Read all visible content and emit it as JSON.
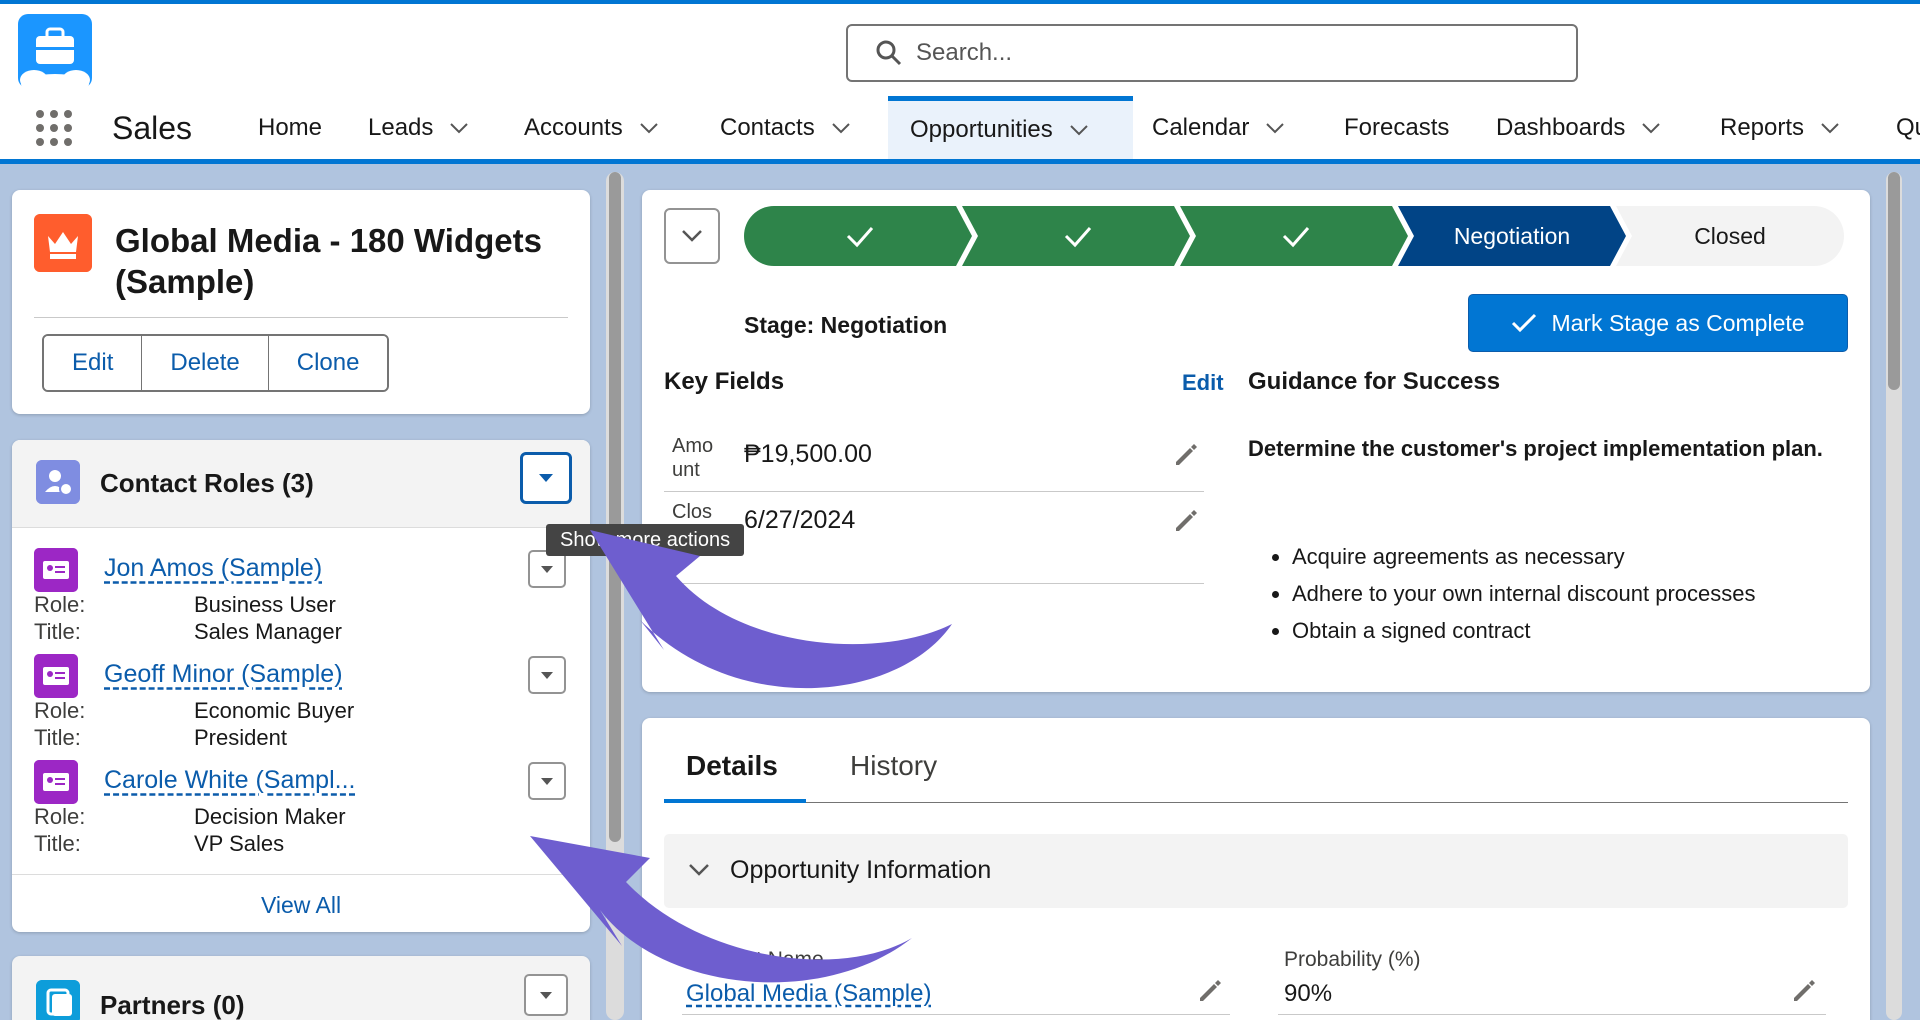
{
  "header": {
    "search_placeholder": "Search...",
    "app_name": "Sales"
  },
  "nav": {
    "items": [
      {
        "label": "Home",
        "has_menu": false
      },
      {
        "label": "Leads",
        "has_menu": true
      },
      {
        "label": "Accounts",
        "has_menu": true
      },
      {
        "label": "Contacts",
        "has_menu": true
      },
      {
        "label": "Opportunities",
        "has_menu": true,
        "active": true
      },
      {
        "label": "Calendar",
        "has_menu": true
      },
      {
        "label": "Forecasts",
        "has_menu": false
      },
      {
        "label": "Dashboards",
        "has_menu": true
      },
      {
        "label": "Reports",
        "has_menu": true
      },
      {
        "label": "Qu",
        "has_menu": false
      }
    ]
  },
  "record": {
    "title": "Global Media - 180 Widgets (Sample)",
    "icon": "crown-icon",
    "actions": [
      "Edit",
      "Delete",
      "Clone"
    ]
  },
  "contact_roles": {
    "title": "Contact Roles (3)",
    "tooltip": "Show more actions",
    "role_label": "Role:",
    "title_label": "Title:",
    "contacts": [
      {
        "name": "Jon Amos (Sample)",
        "role": "Business User",
        "title": "Sales Manager"
      },
      {
        "name": "Geoff Minor (Sample)",
        "role": "Economic Buyer",
        "title": "President"
      },
      {
        "name": "Carole White (Sampl...",
        "role": "Decision Maker",
        "title": "VP Sales"
      }
    ],
    "view_all": "View All"
  },
  "partners": {
    "title": "Partners (0)"
  },
  "path": {
    "steps": [
      {
        "label": "",
        "status": "complete"
      },
      {
        "label": "",
        "status": "complete"
      },
      {
        "label": "",
        "status": "complete"
      },
      {
        "label": "Negotiation",
        "status": "current"
      },
      {
        "label": "Closed",
        "status": "incomplete"
      }
    ],
    "stage_text": "Stage: Negotiation",
    "mark_button": "Mark Stage as Complete"
  },
  "key_fields": {
    "title": "Key Fields",
    "edit": "Edit",
    "fields": [
      {
        "label": "Amo unt",
        "value": "₱19,500.00"
      },
      {
        "label": "Clos",
        "value": "6/27/2024"
      }
    ]
  },
  "guidance": {
    "title": "Guidance for Success",
    "lead": "Determine the customer's project implementation plan.",
    "items": [
      "Acquire agreements as necessary",
      "Adhere to your own internal discount processes",
      "Obtain a signed contract"
    ]
  },
  "details": {
    "tabs": [
      "Details",
      "History"
    ],
    "section": "Opportunity Information",
    "account_label": "Account Name",
    "account_value": "Global Media (Sample)",
    "probability_label": "Probability (%)",
    "probability_value": "90%"
  },
  "colors": {
    "brand": "#0176d3",
    "complete": "#2e844a",
    "current": "#014486",
    "annotation": "#6e5ecf"
  }
}
